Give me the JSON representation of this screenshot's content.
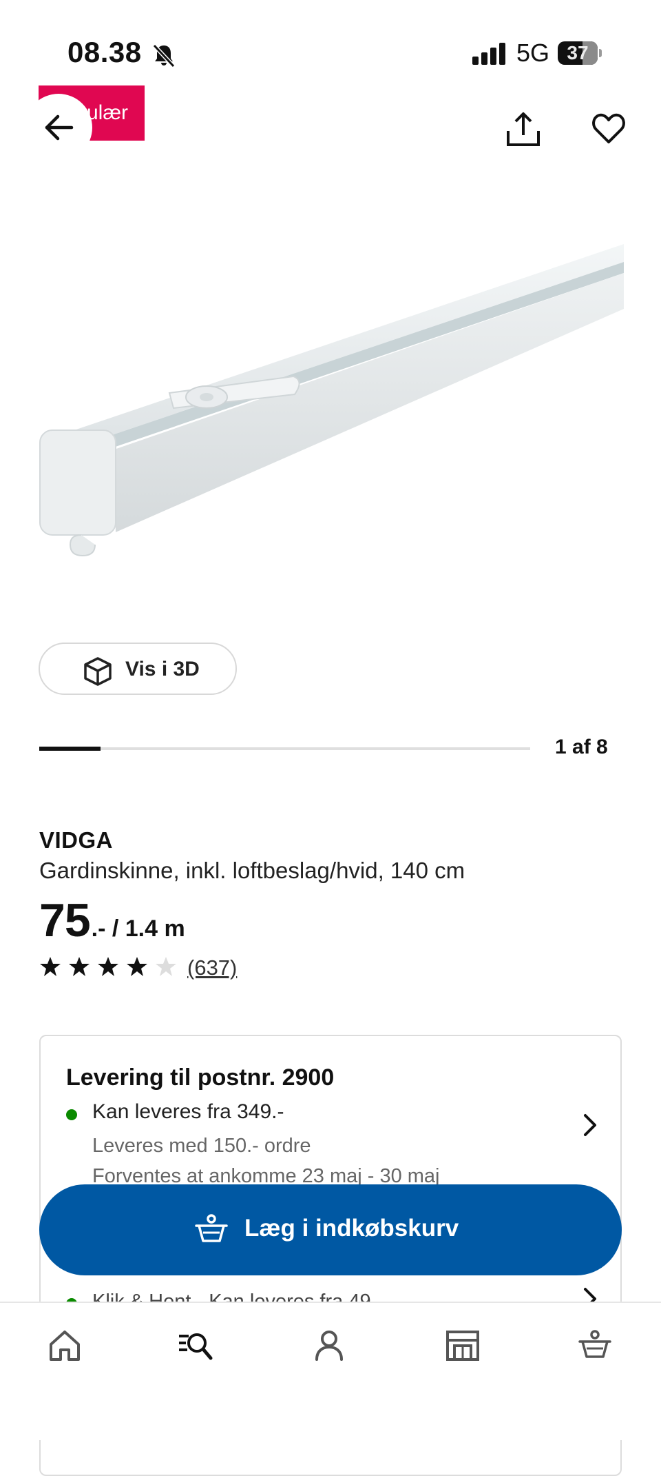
{
  "status_bar": {
    "time": "08.38",
    "network": "5G",
    "battery": "37"
  },
  "header": {
    "badge_text": "ulær",
    "icons": [
      "back-arrow-icon",
      "share-icon",
      "heart-icon"
    ]
  },
  "gallery": {
    "view_3d_label": "Vis i 3D",
    "counter": "1 af 8",
    "progress_fraction": 0.125
  },
  "product": {
    "brand": "VIDGA",
    "description": "Gardinskinne, inkl. loftbeslag/hvid, 140 cm",
    "price_main": "75",
    "price_unit": ".- / 1.4 m",
    "rating_stars": 4,
    "rating_max": 5,
    "reviews_count": "(637)"
  },
  "delivery": {
    "title": "Levering til postnr. 2900",
    "availability": "Kan leveres fra 349.-",
    "min_order": "Leveres med 150.- ordre",
    "eta": "Forventes at ankomme 23 maj - 30 maj",
    "click_collect": "Klik & Hent - Kan leveres fra 49"
  },
  "cart_button": {
    "label": "Læg i indkøbskurv"
  },
  "bottom_nav": {
    "items": [
      "home-icon",
      "search-list-icon",
      "profile-icon",
      "store-icon",
      "basket-icon"
    ]
  },
  "colors": {
    "accent_blue": "#0058a3",
    "badge_pink": "#e00751",
    "availability_green": "#0a8a00"
  }
}
